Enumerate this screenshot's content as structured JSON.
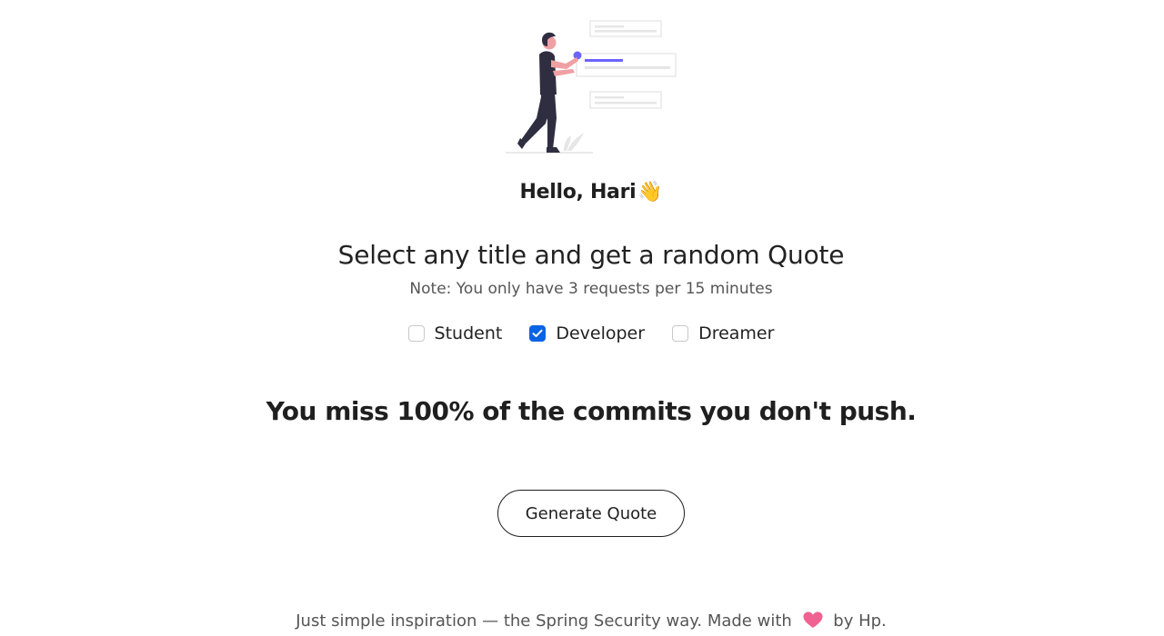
{
  "greeting": {
    "text": "Hello, Hari",
    "emoji": "👋"
  },
  "headline": "Select any title and get a random Quote",
  "note": "Note: You only have 3 requests per 15 minutes",
  "options": [
    {
      "label": "Student",
      "checked": false
    },
    {
      "label": "Developer",
      "checked": true
    },
    {
      "label": "Dreamer",
      "checked": false
    }
  ],
  "quote": "You miss 100% of the commits you don't push.",
  "button": {
    "label": "Generate Quote"
  },
  "footer": {
    "before": "Just simple inspiration — the Spring Security way. Made with",
    "after": "by Hp."
  },
  "colors": {
    "accent": "#6c63ff",
    "checkbox": "#0b63e5",
    "heart": "#f06292"
  },
  "icons": {
    "illustration": "person-with-messages-illustration",
    "wave": "waving-hand-icon",
    "check": "check-icon",
    "heart": "heart-icon"
  }
}
